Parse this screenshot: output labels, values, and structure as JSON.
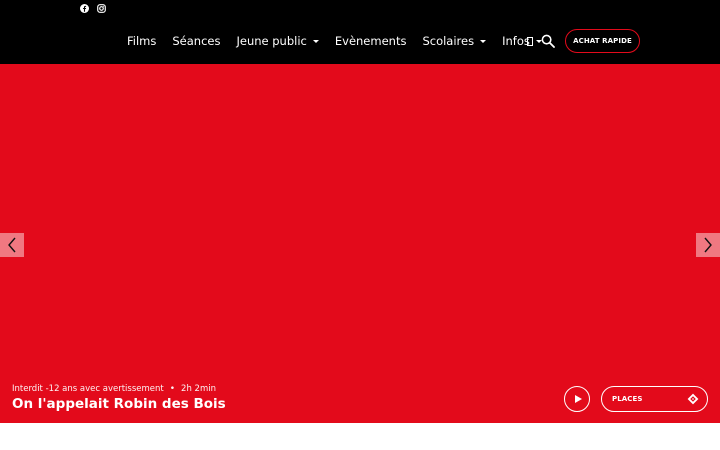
{
  "header": {
    "social": [
      {
        "icon": "facebook-icon"
      },
      {
        "icon": "instagram-icon"
      }
    ],
    "nav": [
      {
        "label": "Films",
        "has_dropdown": false
      },
      {
        "label": "Séances",
        "has_dropdown": false
      },
      {
        "label": "Jeune public",
        "has_dropdown": true
      },
      {
        "label": "Evènements",
        "has_dropdown": false
      },
      {
        "label": "Scolaires",
        "has_dropdown": true
      },
      {
        "label": "Infos",
        "has_dropdown": true
      }
    ],
    "search_icon": "search-icon",
    "quick_buy_label": "ACHAT RAPIDE"
  },
  "hero": {
    "background_color": "#e30a1b",
    "rating": "Interdit -12 ans avec avertissement",
    "separator": "•",
    "duration": "2h 2min",
    "title": "On l'appelait Robin des Bois",
    "places_label": "PLACES"
  },
  "colors": {
    "header_bg": "#000000",
    "accent": "#e30a1b",
    "text": "#ffffff"
  }
}
